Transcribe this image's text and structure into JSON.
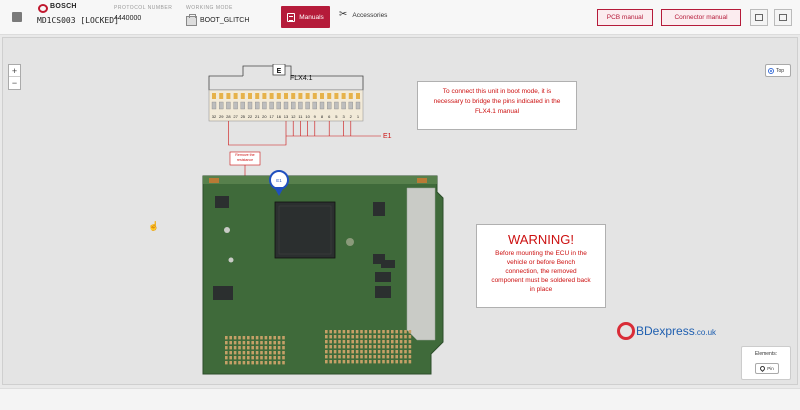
{
  "header": {
    "brand": "BOSCH",
    "model": "MD1CS003 [LOCKED]",
    "protocol_label": "PROTOCOL NUMBER",
    "protocol_value": "4440000",
    "mode_label": "WORKING MODE",
    "mode_value": "BOOT_GLITCH",
    "manuals_label": "Manuals",
    "accessories_label": "Accessories",
    "pcb_manual_label": "PCB manual",
    "connector_manual_label": "Connector manual"
  },
  "canvas": {
    "zoom_in": "+",
    "zoom_out": "−",
    "view_toggle": "Top"
  },
  "diagram": {
    "connector_name": "FLX4.1",
    "connector_tag": "E",
    "pin_numbers": [
      "32",
      "29",
      "28",
      "27",
      "25",
      "22",
      "21",
      "20",
      "17",
      "16",
      "13",
      "12",
      "11",
      "10",
      "9",
      "8",
      "6",
      "5",
      "3",
      "2",
      "1"
    ],
    "bridge_label": "E1",
    "component_note": "Remove the resistance",
    "marker_label": "E1"
  },
  "notes": {
    "boot_mode_text": "To connect this unit in boot mode, it is necessary to bridge the pins indicated in the FLX4.1 manual",
    "warning_title": "WARNING!",
    "warning_text": "Before mounting the ECU in the vehicle or before Bench connection, the removed component must be soldered back in place"
  },
  "watermark": {
    "main": "BDexpress",
    "suffix": ".co.uk"
  },
  "elements_panel": {
    "title": "Elements:",
    "pin_button": "Pin"
  },
  "colors": {
    "accent": "#b51b3a",
    "note_text": "#cc1111",
    "pcb_green": "#3f6a3a"
  }
}
